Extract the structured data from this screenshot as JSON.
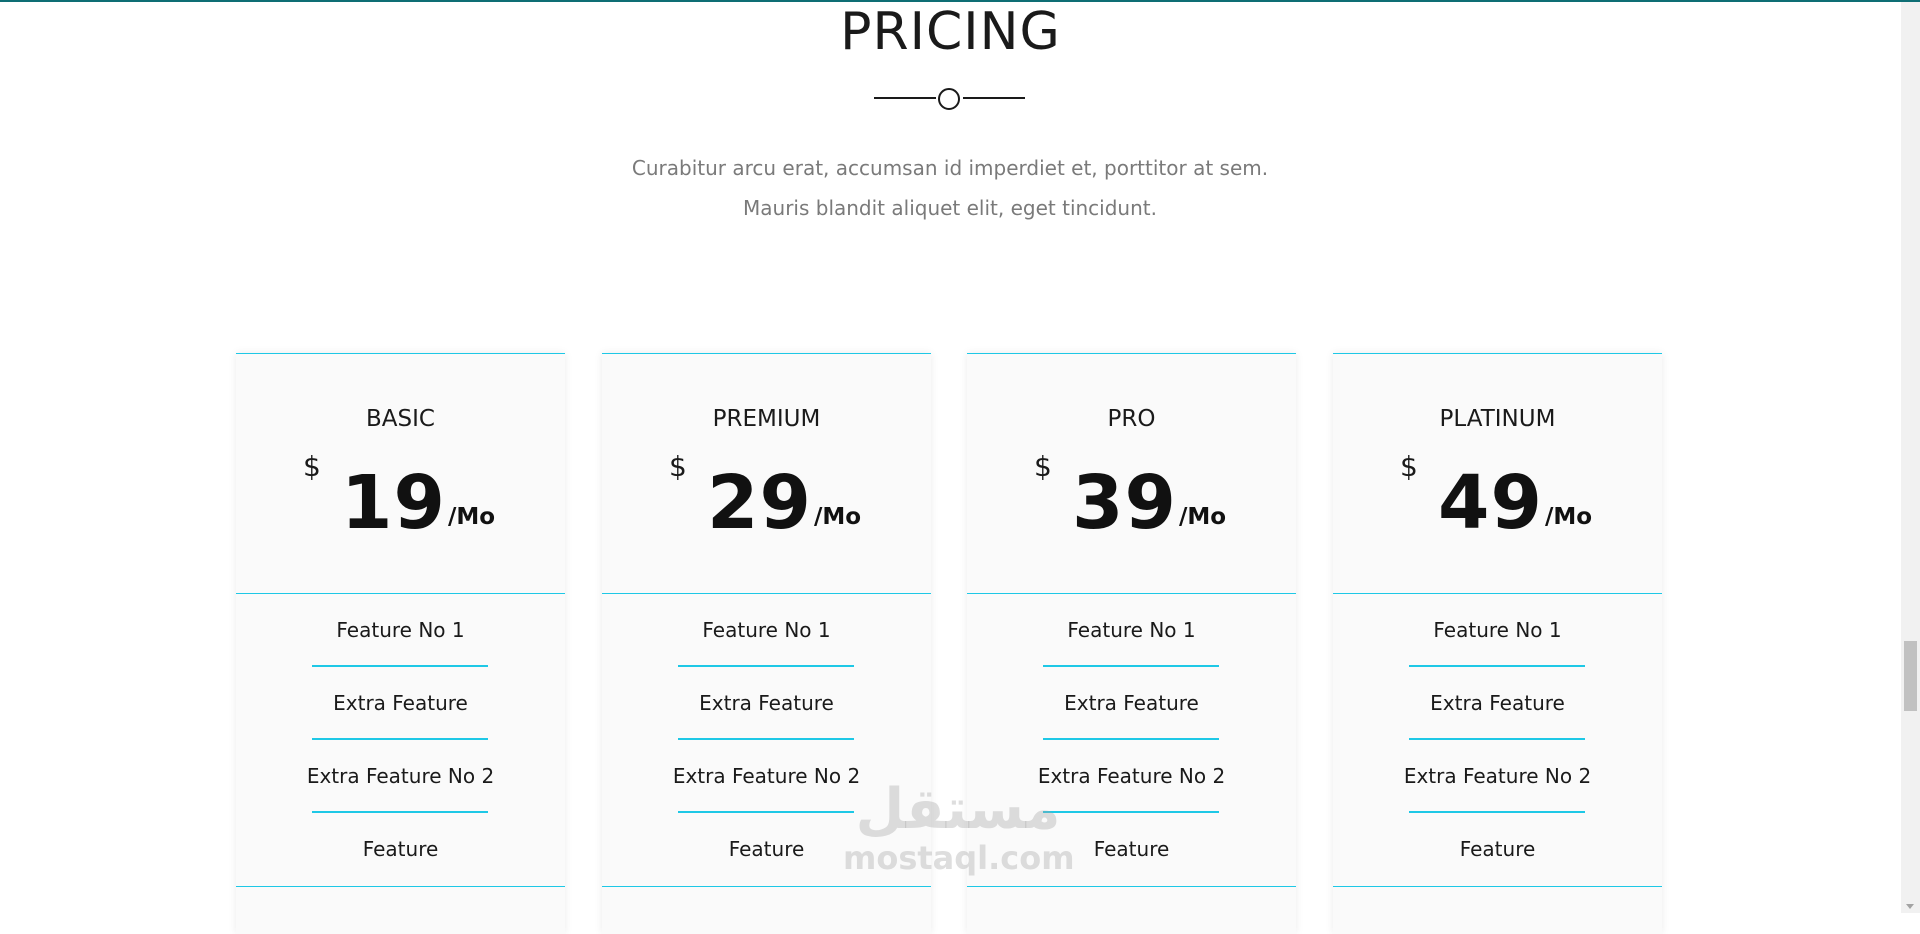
{
  "section": {
    "title": "PRICING",
    "intro": "Curabitur arcu erat, accumsan id imperdiet et, porttitor at sem. Mauris blandit aliquet elit, eget tincidunt."
  },
  "plans": [
    {
      "name": "BASIC",
      "currency": "$",
      "price": "19",
      "period": "/Mo",
      "features": [
        "Feature No 1",
        "Extra Feature",
        "Extra Feature No 2",
        "Feature"
      ]
    },
    {
      "name": "PREMIUM",
      "currency": "$",
      "price": "29",
      "period": "/Mo",
      "features": [
        "Feature No 1",
        "Extra Feature",
        "Extra Feature No 2",
        "Feature"
      ]
    },
    {
      "name": "PRO",
      "currency": "$",
      "price": "39",
      "period": "/Mo",
      "features": [
        "Feature No 1",
        "Extra Feature",
        "Extra Feature No 2",
        "Feature"
      ]
    },
    {
      "name": "PLATINUM",
      "currency": "$",
      "price": "49",
      "period": "/Mo",
      "features": [
        "Feature No 1",
        "Extra Feature",
        "Extra Feature No 2",
        "Feature"
      ]
    }
  ],
  "watermark": {
    "arabic": "مستقل",
    "latin": "mostaql.com"
  },
  "colors": {
    "accent": "#1ec8e6",
    "topbar": "#0e6e74",
    "text": "#1a1a1a",
    "muted": "#7a7a7a"
  }
}
